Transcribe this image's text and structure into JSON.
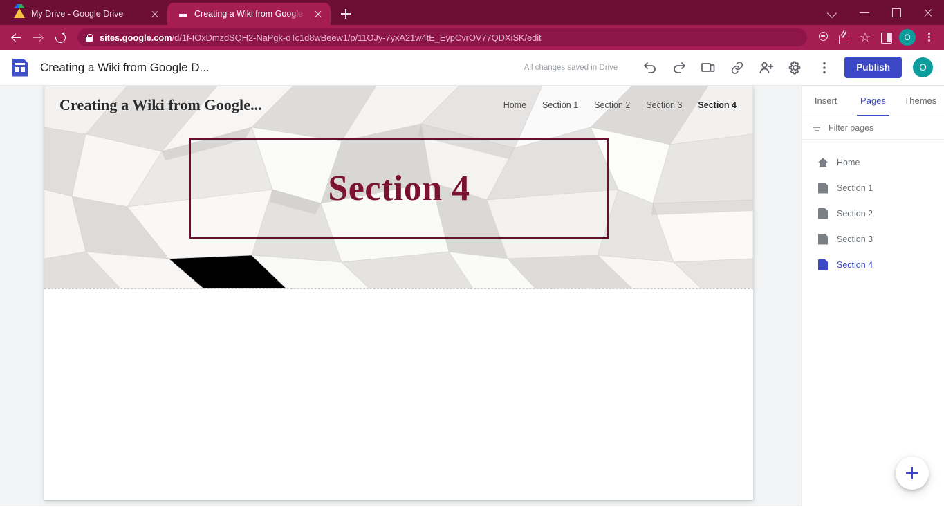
{
  "browser": {
    "tabs": [
      {
        "title": "My Drive - Google Drive",
        "favicon": "google-drive-icon",
        "active": false
      },
      {
        "title": "Creating a Wiki from Google Doc",
        "favicon": "google-sites-icon",
        "active": true
      }
    ],
    "new_tab_label": "+",
    "window_controls": [
      "tab-search-chevron",
      "minimize",
      "maximize",
      "close"
    ],
    "nav": {
      "back": "back-arrow",
      "forward": "forward-arrow",
      "reload": "reload-icon"
    },
    "omnibox": {
      "lock": "lock-icon",
      "url_domain": "sites.google.com",
      "url_path": "/d/1f-IOxDmzdSQH2-NaPgk-oTc1d8wBeew1/p/11OJy-7yxA21w4tE_EypCvrOV77QDXiSK/edit"
    },
    "toolbar_icons": [
      "search-icon",
      "share-icon",
      "bookmark-star-icon",
      "side-panel-icon",
      "kebab-menu-icon"
    ],
    "profile_initial": "O"
  },
  "sites_header": {
    "logo": "google-sites-doc-icon",
    "doc_title": "Creating a Wiki from Google D...",
    "save_status": "All changes saved in Drive",
    "icons": [
      "undo-icon",
      "redo-icon",
      "preview-icon",
      "copy-link-icon",
      "share-with-others-icon",
      "settings-gear-icon",
      "more-options-icon"
    ],
    "publish_label": "Publish",
    "avatar_initial": "O"
  },
  "site": {
    "name": "Creating a Wiki from Google...",
    "nav_links": [
      {
        "label": "Home",
        "active": false
      },
      {
        "label": "Section 1",
        "active": false
      },
      {
        "label": "Section 2",
        "active": false
      },
      {
        "label": "Section 3",
        "active": false
      },
      {
        "label": "Section 4",
        "active": true
      }
    ],
    "page_title": "Section 4"
  },
  "panel": {
    "tabs": [
      {
        "label": "Insert",
        "active": false
      },
      {
        "label": "Pages",
        "active": true
      },
      {
        "label": "Themes",
        "active": false
      }
    ],
    "filter_placeholder": "Filter pages",
    "pages": [
      {
        "label": "Home",
        "icon": "home-icon",
        "selected": false
      },
      {
        "label": "Section 1",
        "icon": "page-icon",
        "selected": false
      },
      {
        "label": "Section 2",
        "icon": "page-icon",
        "selected": false
      },
      {
        "label": "Section 3",
        "icon": "page-icon",
        "selected": false
      },
      {
        "label": "Section 4",
        "icon": "page-icon",
        "selected": true
      }
    ],
    "add_page_label": "+"
  },
  "colors": {
    "browser_frame": "#6d0f35",
    "browser_toolbar": "#a61d54",
    "publish_blue": "#3b49c8",
    "avatar_teal": "#0e9d9d",
    "title_maroon": "#7b1230",
    "border_maroon": "#6e0e2e"
  }
}
